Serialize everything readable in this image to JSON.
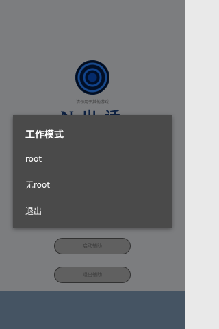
{
  "background": {
    "tagline": "请勿用于其他游戏",
    "brand_text": "N 出 话",
    "start_button_label": "启动辅助",
    "exit_button_label": "退出辅助"
  },
  "dialog": {
    "title": "工作模式",
    "options": [
      {
        "label": "root"
      },
      {
        "label": "无root"
      },
      {
        "label": "退出"
      }
    ]
  },
  "colors": {
    "dialog_bg": "#4a4a4a",
    "dialog_text": "#ffffff",
    "bottom_bar": "#7f9ab4"
  }
}
